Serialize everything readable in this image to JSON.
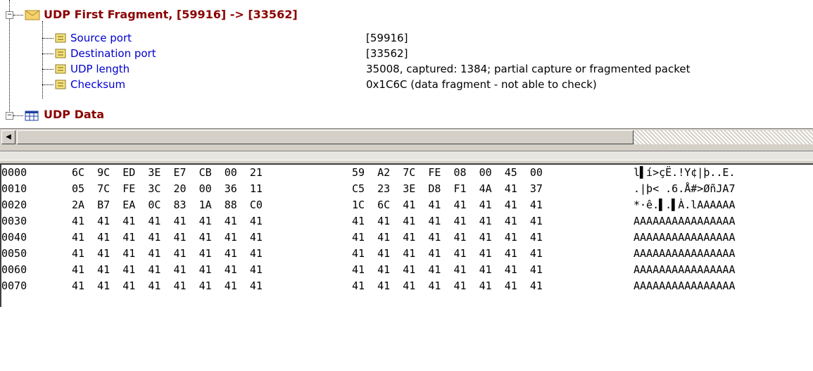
{
  "tree": {
    "header": {
      "label": "UDP First Fragment, [59916]  -> [33562]"
    },
    "fields": [
      {
        "name": "Source port",
        "value": "[59916]"
      },
      {
        "name": "Destination port",
        "value": "[33562]"
      },
      {
        "name": "UDP length",
        "value": "35008,  captured: 1384; partial capture or fragmented packet"
      },
      {
        "name": "Checksum",
        "value": "0x1C6C (data fragment - not able to check)"
      }
    ],
    "data_node": {
      "label": "UDP Data"
    },
    "expander_symbol": "−"
  },
  "scrollbar": {
    "left_arrow": "◀"
  },
  "hex": {
    "rows": [
      {
        "offset": "0000",
        "bytes1": "6C  9C  ED  3E  E7  CB  00  21",
        "bytes2": "59  A2  7C  FE  08  00  45  00",
        "ascii": "l▌í>çË.!Y¢|þ..E."
      },
      {
        "offset": "0010",
        "bytes1": "05  7C  FE  3C  20  00  36  11",
        "bytes2": "C5  23  3E  D8  F1  4A  41  37",
        "ascii": ".|þ< .6.Å#>ØñJA7"
      },
      {
        "offset": "0020",
        "bytes1": "2A  B7  EA  0C  83  1A  88  C0",
        "bytes2": "1C  6C  41  41  41  41  41  41",
        "ascii": "*·ê.▌.▌À.lAAAAAA"
      },
      {
        "offset": "0030",
        "bytes1": "41  41  41  41  41  41  41  41",
        "bytes2": "41  41  41  41  41  41  41  41",
        "ascii": "AAAAAAAAAAAAAAAA"
      },
      {
        "offset": "0040",
        "bytes1": "41  41  41  41  41  41  41  41",
        "bytes2": "41  41  41  41  41  41  41  41",
        "ascii": "AAAAAAAAAAAAAAAA"
      },
      {
        "offset": "0050",
        "bytes1": "41  41  41  41  41  41  41  41",
        "bytes2": "41  41  41  41  41  41  41  41",
        "ascii": "AAAAAAAAAAAAAAAA"
      },
      {
        "offset": "0060",
        "bytes1": "41  41  41  41  41  41  41  41",
        "bytes2": "41  41  41  41  41  41  41  41",
        "ascii": "AAAAAAAAAAAAAAAA"
      },
      {
        "offset": "0070",
        "bytes1": "41  41  41  41  41  41  41  41",
        "bytes2": "41  41  41  41  41  41  41  41",
        "ascii": "AAAAAAAAAAAAAAAA"
      }
    ]
  },
  "colors": {
    "header": "#8b0000",
    "field": "#0000cc",
    "value": "#000000"
  },
  "icons": {
    "header": "envelope-icon",
    "field": "note-icon",
    "data": "table-icon"
  }
}
